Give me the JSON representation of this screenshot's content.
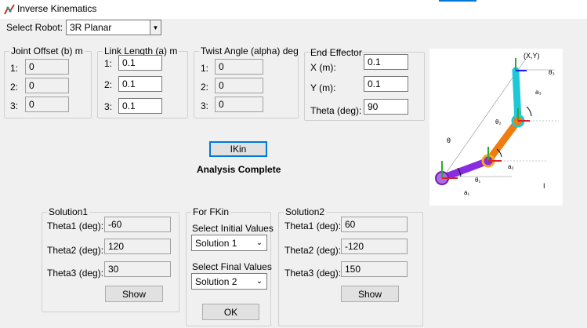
{
  "window": {
    "title": "Inverse Kinematics"
  },
  "colors": {
    "accent": "#0078d7",
    "link_purple": "#8a2be2",
    "link_orange": "#f07c10",
    "link_cyan": "#1fc8d8"
  },
  "robot": {
    "label": "Select Robot:",
    "selected": "3R Planar"
  },
  "joint_offset": {
    "title": "Joint Offset (b) m",
    "rows": [
      {
        "n": "1:",
        "v": "0"
      },
      {
        "n": "2:",
        "v": "0"
      },
      {
        "n": "3:",
        "v": "0"
      }
    ]
  },
  "link_length": {
    "title": "Link Length (a) m",
    "rows": [
      {
        "n": "1:",
        "v": "0.1"
      },
      {
        "n": "2:",
        "v": "0.1"
      },
      {
        "n": "3:",
        "v": "0.1"
      }
    ]
  },
  "twist_angle": {
    "title": "Twist Angle (alpha) deg",
    "rows": [
      {
        "n": "1:",
        "v": "0"
      },
      {
        "n": "2:",
        "v": "0"
      },
      {
        "n": "3:",
        "v": "0"
      }
    ]
  },
  "end_effector": {
    "title": "End Effector",
    "x_label": "X (m):",
    "x_value": "0.1",
    "y_label": "Y (m):",
    "y_value": "0.1",
    "theta_label": "Theta (deg):",
    "theta_value": "90"
  },
  "ikin": {
    "button": "IKin",
    "status": "Analysis Complete"
  },
  "solution1": {
    "title": "Solution1",
    "rows": [
      {
        "label": "Theta1 (deg):",
        "value": "-60"
      },
      {
        "label": "Theta2 (deg):",
        "value": "120"
      },
      {
        "label": "Theta3 (deg):",
        "value": "30"
      }
    ],
    "show": "Show"
  },
  "fkin": {
    "title": "For FKin",
    "initial_label": "Select Initial Values",
    "initial_value": "Solution 1",
    "final_label": "Select Final Values",
    "final_value": "Solution 2",
    "ok": "OK"
  },
  "solution2": {
    "title": "Solution2",
    "rows": [
      {
        "label": "Theta1 (deg):",
        "value": "60"
      },
      {
        "label": "Theta2 (deg):",
        "value": "-120"
      },
      {
        "label": "Theta3 (deg):",
        "value": "150"
      }
    ],
    "show": "Show"
  },
  "diagram": {
    "point_label": "(X,Y)",
    "theta": "θ",
    "theta1": "θ₁",
    "theta2": "θ₂",
    "theta3": "θ₃",
    "a1": "a₁",
    "a2": "a₂",
    "a3": "a₃",
    "cursor": "I"
  }
}
